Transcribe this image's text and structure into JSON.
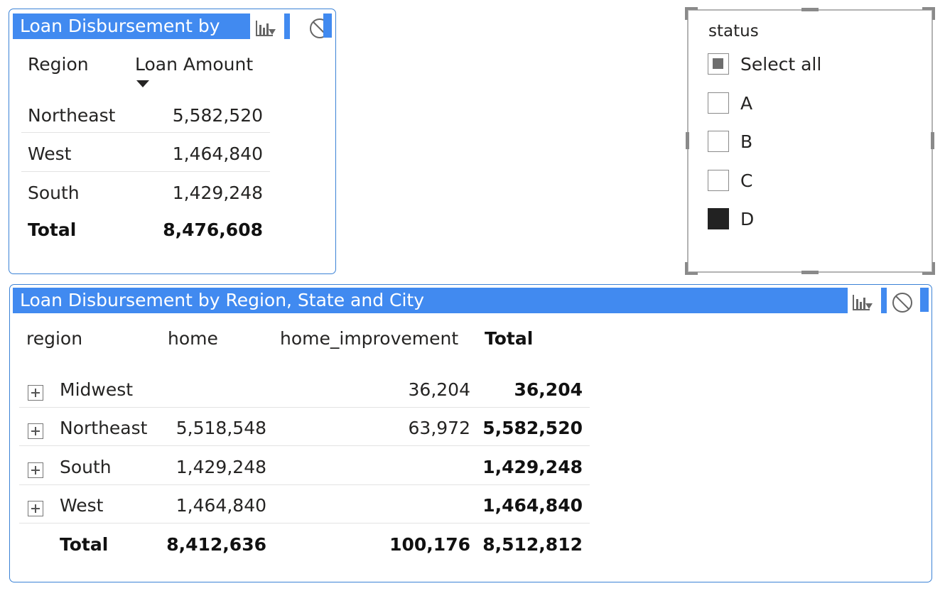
{
  "top_table": {
    "title": "Loan Disbursement by",
    "columns": [
      "Region",
      "Loan Amount"
    ],
    "rows": [
      {
        "region": "Northeast",
        "amount": "5,582,520"
      },
      {
        "region": "West",
        "amount": "1,464,840"
      },
      {
        "region": "South",
        "amount": "1,429,248"
      }
    ],
    "total": {
      "label": "Total",
      "amount": "8,476,608"
    }
  },
  "slicer": {
    "title": "status",
    "items": [
      {
        "label": "Select all",
        "state": "partial"
      },
      {
        "label": "A",
        "state": "unchecked"
      },
      {
        "label": "B",
        "state": "unchecked"
      },
      {
        "label": "C",
        "state": "unchecked"
      },
      {
        "label": "D",
        "state": "checked"
      }
    ]
  },
  "matrix": {
    "title": "Loan Disbursement by Region, State and City",
    "columns": [
      "region",
      "home",
      "home_improvement",
      "Total"
    ],
    "rows": [
      {
        "region": "Midwest",
        "home": "",
        "home_improvement": "36,204",
        "total": "36,204"
      },
      {
        "region": "Northeast",
        "home": "5,518,548",
        "home_improvement": "63,972",
        "total": "5,582,520"
      },
      {
        "region": "South",
        "home": "1,429,248",
        "home_improvement": "",
        "total": "1,429,248"
      },
      {
        "region": "West",
        "home": "1,464,840",
        "home_improvement": "",
        "total": "1,464,840"
      }
    ],
    "total": {
      "label": "Total",
      "home": "8,412,636",
      "home_improvement": "100,176",
      "total": "8,512,812"
    }
  },
  "icons": [
    "drill-chart-icon",
    "block-icon",
    "expand-icon"
  ],
  "colors": {
    "accent": "#418af0",
    "border": "#3b82d6"
  }
}
